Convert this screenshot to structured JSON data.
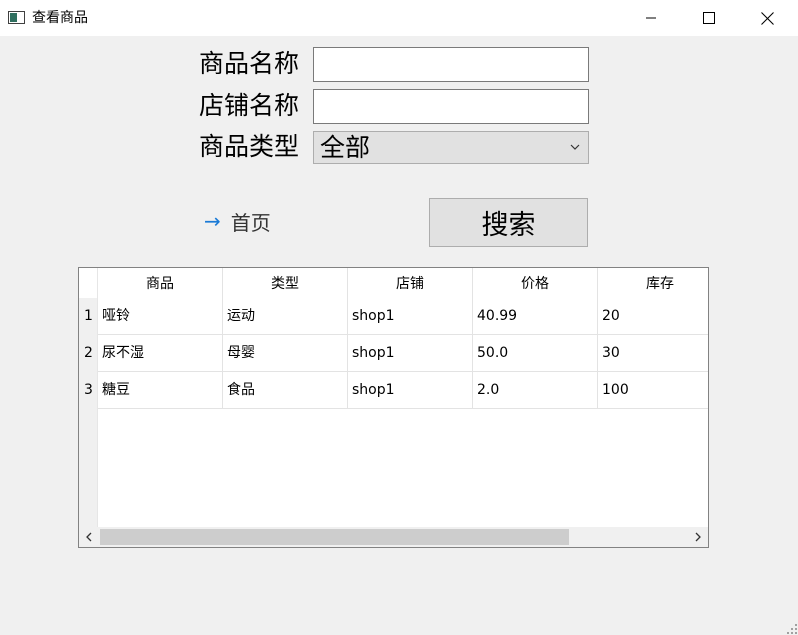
{
  "window": {
    "title": "查看商品",
    "controls": [
      "minimize",
      "maximize",
      "close"
    ]
  },
  "form": {
    "name_label": "商品名称",
    "name_value": "",
    "shop_label": "店铺名称",
    "shop_value": "",
    "type_label": "商品类型",
    "type_selected": "全部"
  },
  "actions": {
    "home_label": "首页",
    "search_label": "搜索"
  },
  "table": {
    "columns": [
      "商品",
      "类型",
      "店铺",
      "价格",
      "库存"
    ],
    "row_numbers": [
      "1",
      "2",
      "3"
    ],
    "rows": [
      [
        "哑铃",
        "运动",
        "shop1",
        "40.99",
        "20"
      ],
      [
        "尿不湿",
        "母婴",
        "shop1",
        "50.0",
        "30"
      ],
      [
        "糖豆",
        "食品",
        "shop1",
        "2.0",
        "100"
      ]
    ]
  },
  "icons": {
    "app": "app-window-icon",
    "home": "arrow-right-icon",
    "combo": "chevron-down-icon"
  },
  "colors": {
    "background": "#f0f0f0",
    "button": "#e1e1e1",
    "link_arrow": "#1a7ad6"
  }
}
